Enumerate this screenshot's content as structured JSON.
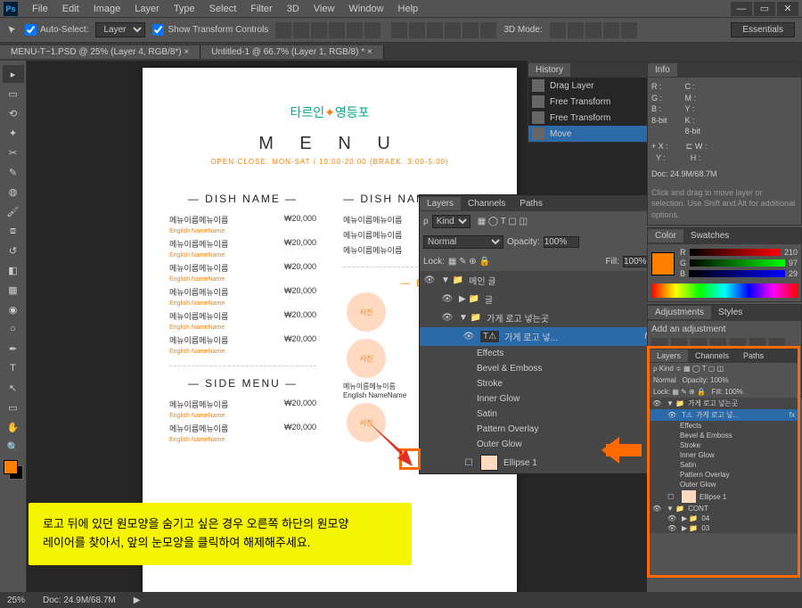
{
  "app": {
    "name": "Ps"
  },
  "menu": [
    "File",
    "Edit",
    "Image",
    "Layer",
    "Type",
    "Select",
    "Filter",
    "3D",
    "View",
    "Window",
    "Help"
  ],
  "options": {
    "auto_select": "Auto-Select:",
    "auto_select_value": "Layer",
    "show_transform": "Show Transform Controls",
    "mode_3d": "3D Mode:",
    "workspace": "Essentials"
  },
  "tabs": [
    "MENU-T~1.PSD @ 25% (Layer 4, RGB/8*) ×",
    "Untitled-1 @ 66.7% (Layer 1, RGB/8) * ×"
  ],
  "history": {
    "title": "History",
    "items": [
      "Drag Layer",
      "Free Transform",
      "Free Transform",
      "Move"
    ]
  },
  "info": {
    "title": "Info",
    "r": "R :",
    "g": "G :",
    "b": "B :",
    "eight": "8-bit",
    "c": "C :",
    "m": "M :",
    "y": "Y :",
    "k": "K :",
    "x": "X :",
    "yy": "Y :",
    "w": "W :",
    "h": "H :",
    "doc": "Doc: 24.9M/68.7M",
    "hint": "Click and drag to move layer or selection. Use Shift and Alt for additional options."
  },
  "color": {
    "title": "Color",
    "swatches": "Swatches",
    "r": "R",
    "r_val": "210",
    "g": "G",
    "g_val": "97",
    "b": "B",
    "b_val": "29"
  },
  "adjustments": {
    "title": "Adjustments",
    "styles": "Styles",
    "add": "Add an adjustment"
  },
  "layers": {
    "tab_layers": "Layers",
    "tab_channels": "Channels",
    "tab_paths": "Paths",
    "kind": "Kind",
    "blend": "Normal",
    "opacity_label": "Opacity:",
    "opacity": "100%",
    "lock": "Lock:",
    "fill_label": "Fill:",
    "fill": "100%",
    "group1": "메인 글",
    "group2": "글",
    "group3": "가게 로고 넣는곳",
    "text_layer": "가게 로고 넣...",
    "effects": "Effects",
    "fx": [
      "Bevel & Emboss",
      "Stroke",
      "Inner Glow",
      "Satin",
      "Pattern Overlay",
      "Outer Glow"
    ],
    "ellipse": "Ellipse 1",
    "cont": "CONT",
    "g04": "04",
    "g03": "03"
  },
  "doc": {
    "logo1": "타르인",
    "logo2": "영등포",
    "menu_title": "M E N U",
    "hours": "OPEN-CLOSE. MON-SAT / 10:00-20:00 (BRAEK. 3:00-5:00)",
    "dish": "— DISH NAME —",
    "side": "— SIDE MENU —",
    "best": "— BE",
    "item_name": "메뉴이름메뉴이름",
    "item_sub": "English NameName",
    "price": "₩20,000",
    "photo": "사진"
  },
  "note": {
    "line1": "로고 뒤에 있던 원모양을 숨기고 싶은 경우 오른쪽 하단의 원모양",
    "line2": "레이어를 찾아서, 앞의 눈모양을 클릭하여 해제해주세요."
  },
  "status": {
    "zoom": "25%",
    "doc": "Doc: 24.9M/68.7M"
  }
}
